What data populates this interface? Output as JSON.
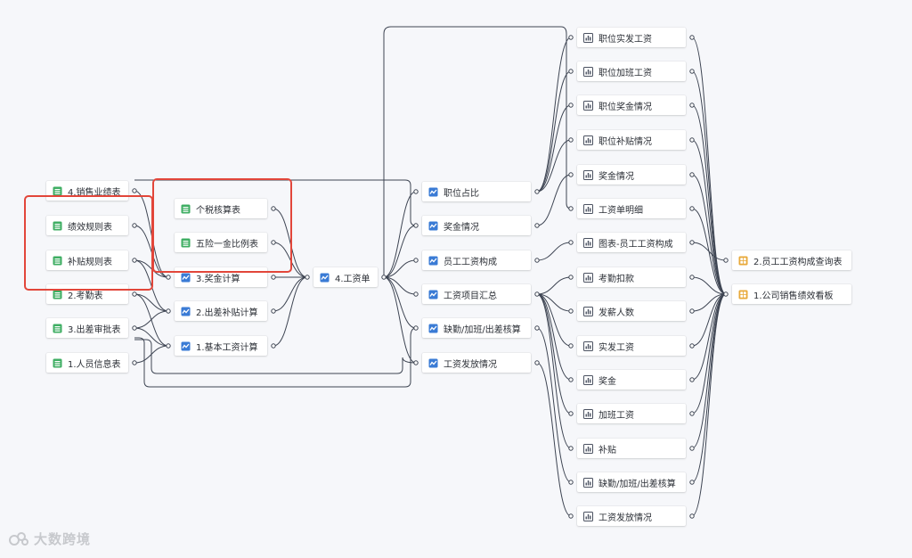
{
  "nodes": [
    {
      "id": "sales",
      "label": "4.销售业绩表",
      "type": "table"
    },
    {
      "id": "perf_rule",
      "label": "绩效规则表",
      "type": "table"
    },
    {
      "id": "subsidy_rule",
      "label": "补贴规则表",
      "type": "table"
    },
    {
      "id": "attendance",
      "label": "2.考勤表",
      "type": "table"
    },
    {
      "id": "trip_approval",
      "label": "3.出差审批表",
      "type": "table"
    },
    {
      "id": "staff_info",
      "label": "1.人员信息表",
      "type": "table"
    },
    {
      "id": "tax",
      "label": "个税核算表",
      "type": "table"
    },
    {
      "id": "insurance",
      "label": "五险一金比例表",
      "type": "table"
    },
    {
      "id": "bonus_calc",
      "label": "3.奖金计算",
      "type": "flow"
    },
    {
      "id": "trip_calc",
      "label": "2.出差补贴计算",
      "type": "flow"
    },
    {
      "id": "base_calc",
      "label": "1.基本工资计算",
      "type": "flow"
    },
    {
      "id": "payroll",
      "label": "4.工资单",
      "type": "flow"
    },
    {
      "id": "pos_ratio",
      "label": "职位占比",
      "type": "flow"
    },
    {
      "id": "bonus_status",
      "label": "奖金情况",
      "type": "flow"
    },
    {
      "id": "wage_comp",
      "label": "员工工资构成",
      "type": "flow"
    },
    {
      "id": "wage_sum",
      "label": "工资项目汇总",
      "type": "flow"
    },
    {
      "id": "absence",
      "label": "缺勤/加班/出差核算",
      "type": "flow"
    },
    {
      "id": "pay_status",
      "label": "工资发放情况",
      "type": "flow"
    },
    {
      "id": "c_pos_actual",
      "label": "职位实发工资",
      "type": "chart"
    },
    {
      "id": "c_pos_ot",
      "label": "职位加班工资",
      "type": "chart"
    },
    {
      "id": "c_pos_bonus",
      "label": "职位奖金情况",
      "type": "chart"
    },
    {
      "id": "c_pos_sub",
      "label": "职位补贴情况",
      "type": "chart"
    },
    {
      "id": "c_bonus",
      "label": "奖金情况",
      "type": "chart"
    },
    {
      "id": "c_detail",
      "label": "工资单明细",
      "type": "chart"
    },
    {
      "id": "c_comp",
      "label": "图表-员工工资构成",
      "type": "chart"
    },
    {
      "id": "c_deduct",
      "label": "考勤扣款",
      "type": "chart"
    },
    {
      "id": "c_count",
      "label": "发薪人数",
      "type": "chart"
    },
    {
      "id": "c_actual",
      "label": "实发工资",
      "type": "chart"
    },
    {
      "id": "c_bonus2",
      "label": "奖金",
      "type": "chart"
    },
    {
      "id": "c_ot",
      "label": "加班工资",
      "type": "chart"
    },
    {
      "id": "c_sub",
      "label": "补贴",
      "type": "chart"
    },
    {
      "id": "c_absence",
      "label": "缺勤/加班/出差核算",
      "type": "chart"
    },
    {
      "id": "c_pay",
      "label": "工资发放情况",
      "type": "chart"
    },
    {
      "id": "d_query",
      "label": "2.员工工资构成查询表",
      "type": "dashboard"
    },
    {
      "id": "d_board",
      "label": "1.公司销售绩效看板",
      "type": "dashboard"
    }
  ],
  "edges": [
    [
      "perf_rule",
      "bonus_calc"
    ],
    [
      "subsidy_rule",
      "bonus_calc"
    ],
    [
      "sales",
      "bonus_calc"
    ],
    [
      "subsidy_rule",
      "trip_calc"
    ],
    [
      "attendance",
      "trip_calc"
    ],
    [
      "trip_approval",
      "trip_calc"
    ],
    [
      "attendance",
      "base_calc"
    ],
    [
      "trip_approval",
      "base_calc"
    ],
    [
      "staff_info",
      "base_calc"
    ],
    [
      "tax",
      "payroll"
    ],
    [
      "insurance",
      "payroll"
    ],
    [
      "bonus_calc",
      "payroll"
    ],
    [
      "trip_calc",
      "payroll"
    ],
    [
      "base_calc",
      "payroll"
    ],
    [
      "sales",
      "bonus_status"
    ],
    [
      "staff_info",
      "pay_status"
    ],
    [
      "trip_approval",
      "absence"
    ],
    [
      "payroll",
      "pos_ratio"
    ],
    [
      "payroll",
      "bonus_status"
    ],
    [
      "payroll",
      "wage_comp"
    ],
    [
      "payroll",
      "wage_sum"
    ],
    [
      "payroll",
      "absence"
    ],
    [
      "payroll",
      "pay_status"
    ],
    [
      "payroll",
      "c_detail"
    ],
    [
      "pos_ratio",
      "c_pos_actual"
    ],
    [
      "pos_ratio",
      "c_pos_ot"
    ],
    [
      "pos_ratio",
      "c_pos_bonus"
    ],
    [
      "pos_ratio",
      "c_pos_sub"
    ],
    [
      "bonus_status",
      "c_bonus"
    ],
    [
      "wage_comp",
      "c_comp"
    ],
    [
      "wage_sum",
      "c_deduct"
    ],
    [
      "wage_sum",
      "c_count"
    ],
    [
      "wage_sum",
      "c_actual"
    ],
    [
      "wage_sum",
      "c_bonus2"
    ],
    [
      "wage_sum",
      "c_ot"
    ],
    [
      "wage_sum",
      "c_sub"
    ],
    [
      "absence",
      "c_absence"
    ],
    [
      "pay_status",
      "c_pay"
    ],
    [
      "c_comp",
      "d_query"
    ],
    [
      "c_pos_actual",
      "d_board"
    ],
    [
      "c_pos_ot",
      "d_board"
    ],
    [
      "c_pos_bonus",
      "d_board"
    ],
    [
      "c_pos_sub",
      "d_board"
    ],
    [
      "c_bonus",
      "d_board"
    ],
    [
      "c_detail",
      "d_board"
    ],
    [
      "c_deduct",
      "d_board"
    ],
    [
      "c_count",
      "d_board"
    ],
    [
      "c_actual",
      "d_board"
    ],
    [
      "c_bonus2",
      "d_board"
    ],
    [
      "c_ot",
      "d_board"
    ],
    [
      "c_sub",
      "d_board"
    ],
    [
      "c_absence",
      "d_board"
    ],
    [
      "c_pay",
      "d_board"
    ]
  ],
  "highlight_groups": [
    [
      "perf_rule",
      "subsidy_rule"
    ],
    [
      "tax",
      "insurance"
    ]
  ],
  "colors": {
    "table": "#3fae63",
    "flow": "#3a7bd5",
    "chart": "#4a5160",
    "dashboard": "#e8a93a",
    "edge": "#3d4452",
    "highlight": "#e2463a"
  },
  "icons": {
    "table": "table-icon",
    "flow": "dataflow-icon",
    "chart": "chart-icon",
    "dashboard": "dashboard-icon"
  },
  "watermark": {
    "text": "大数跨境"
  }
}
